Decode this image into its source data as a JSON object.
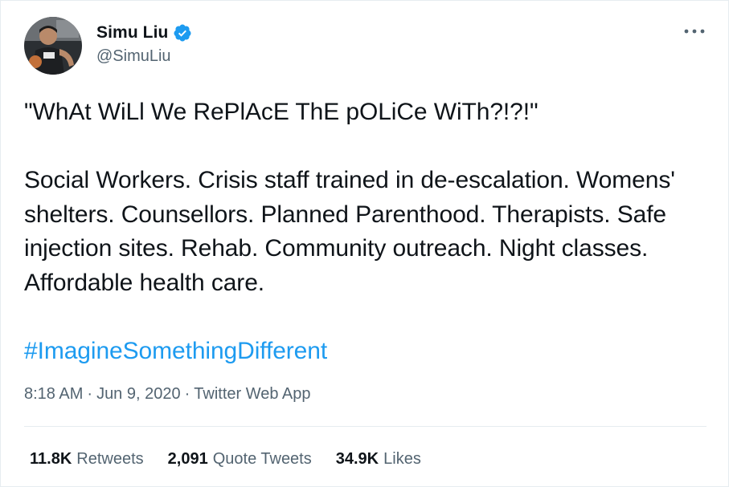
{
  "user": {
    "display_name": "Simu Liu",
    "handle": "@SimuLiu",
    "verified_icon": "verified-badge-icon",
    "avatar_icon": "profile-photo"
  },
  "menu": {
    "more_icon": "more-horizontal-icon"
  },
  "tweet": {
    "line1": "\"WhAt WiLl We RePlAcE ThE pOLiCe WiTh?!?!\"",
    "paragraph2": "Social Workers. Crisis staff trained in de-escalation. Womens' shelters. Counsellors. Planned Parenthood. Therapists. Safe injection sites. Rehab. Community outreach. Night classes. Affordable health care.",
    "hashtag": "#ImagineSomethingDifferent"
  },
  "meta": {
    "time": "8:18 AM",
    "separator": "·",
    "date": "Jun 9, 2020",
    "source": "Twitter Web App"
  },
  "stats": {
    "retweets_count": "11.8K",
    "retweets_label": "Retweets",
    "quotes_count": "2,091",
    "quotes_label": "Quote Tweets",
    "likes_count": "34.9K",
    "likes_label": "Likes"
  },
  "colors": {
    "link": "#1d9bf0",
    "secondary_text": "#536471",
    "primary_text": "#0f1419",
    "divider": "#e6ecf0"
  }
}
